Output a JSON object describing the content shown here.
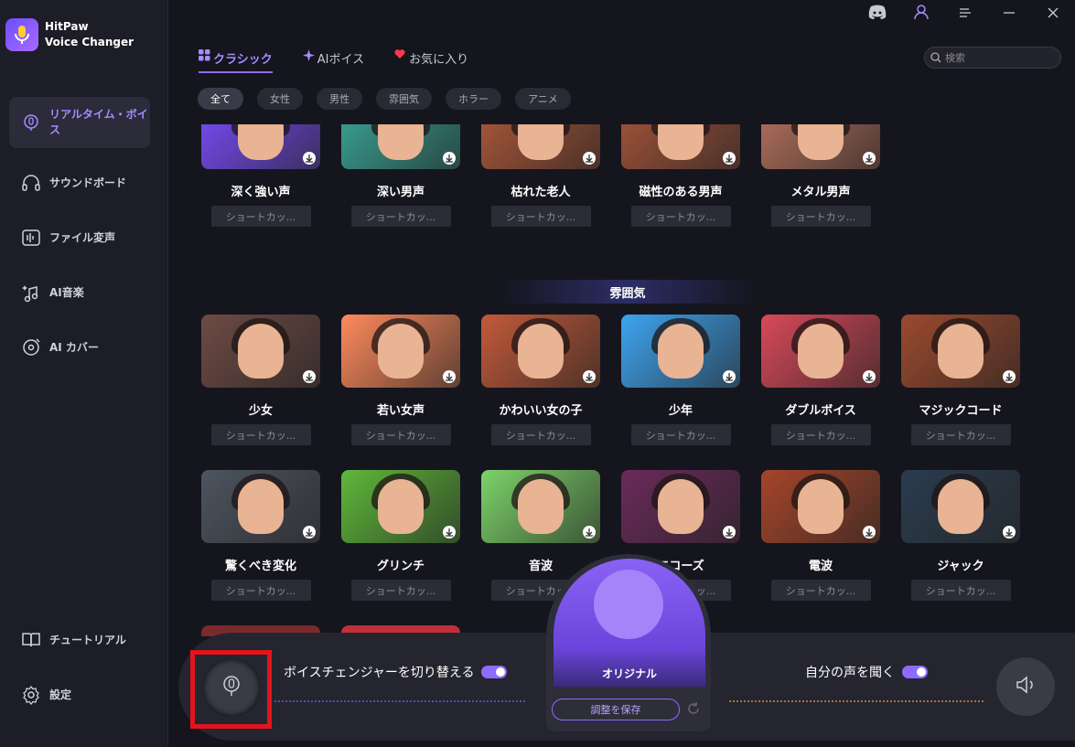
{
  "app": {
    "name_line1": "HitPaw",
    "name_line2": "Voice Changer"
  },
  "sidebar": {
    "items": [
      {
        "label": "リアルタイム・ボイス",
        "icon": "mic-icon",
        "active": true
      },
      {
        "label": "サウンドボード",
        "icon": "headphones-icon"
      },
      {
        "label": "ファイル変声",
        "icon": "file-voice-icon"
      },
      {
        "label": "AI音楽",
        "icon": "ai-music-icon"
      },
      {
        "label": "AI カバー",
        "icon": "ai-cover-icon"
      }
    ],
    "tutorial": "チュートリアル",
    "settings": "設定"
  },
  "tabs": [
    {
      "label": "クラシック",
      "active": true
    },
    {
      "label": "AIボイス"
    },
    {
      "label": "お気に入り"
    }
  ],
  "search": {
    "placeholder": "検索"
  },
  "filters": [
    "全て",
    "女性",
    "男性",
    "雰囲気",
    "ホラー",
    "アニメ"
  ],
  "section_title": "雰囲気",
  "shortcut_label": "ショートカッ...",
  "row1": [
    {
      "name": "深く強い声",
      "color": "#7b4dff"
    },
    {
      "name": "深い男声",
      "color": "#3aa89a"
    },
    {
      "name": "枯れた老人",
      "color": "#b05a3a"
    },
    {
      "name": "磁性のある男声",
      "color": "#a8553a"
    },
    {
      "name": "メタル男声",
      "color": "#b8735e"
    }
  ],
  "row2": [
    {
      "name": "少女",
      "color": "#6e4a44"
    },
    {
      "name": "若い女声",
      "color": "#ff8a5c"
    },
    {
      "name": "かわいい女の子",
      "color": "#c25a3a"
    },
    {
      "name": "少年",
      "color": "#3ea4f0"
    },
    {
      "name": "ダブルボイス",
      "color": "#d9495a"
    },
    {
      "name": "マジックコード",
      "color": "#9c4a2e"
    }
  ],
  "row3": [
    {
      "name": "驚くべき変化",
      "color": "#4e5560"
    },
    {
      "name": "グリンチ",
      "color": "#5fb83a"
    },
    {
      "name": "音波",
      "color": "#7dd36a"
    },
    {
      "name": "エコーズ",
      "color": "#6a2a5a"
    },
    {
      "name": "電波",
      "color": "#a6452a"
    },
    {
      "name": "ジャック",
      "color": "#2a3c4e"
    }
  ],
  "bottom": {
    "switch_label": "ボイスチェンジャーを切り替える",
    "listen_label": "自分の声を聞く",
    "original": "オリジナル",
    "save_button": "調整を保存"
  }
}
